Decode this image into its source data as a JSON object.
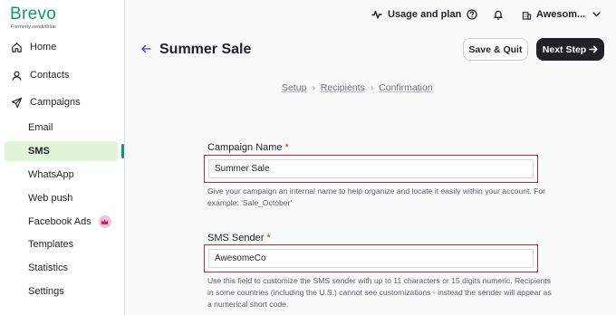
{
  "brand": {
    "name": "Brevo",
    "sub": "Formerly sendinblue",
    "color": "#0b996e"
  },
  "sidebar": {
    "items": [
      {
        "label": "Home",
        "icon": "home-icon"
      },
      {
        "label": "Contacts",
        "icon": "contacts-icon"
      },
      {
        "label": "Campaigns",
        "icon": "send-icon"
      },
      {
        "label": "Email"
      },
      {
        "label": "SMS",
        "active": true
      },
      {
        "label": "WhatsApp"
      },
      {
        "label": "Web push"
      },
      {
        "label": "Facebook Ads",
        "badge_icon": "crown-icon"
      },
      {
        "label": "Templates"
      },
      {
        "label": "Statistics"
      },
      {
        "label": "Settings"
      }
    ]
  },
  "topbar": {
    "usage_label": "Usage and plan",
    "account_label": "Awesom..."
  },
  "header": {
    "title": "Summer Sale",
    "save_label": "Save & Quit",
    "next_label": "Next Step"
  },
  "breadcrumb": [
    "Setup",
    "Recipients",
    "Confirmation"
  ],
  "form": {
    "campaign_name": {
      "label": "Campaign Name",
      "required": "*",
      "value": "Summer Sale",
      "help": "Give your campaign an internal name to help organize and locate it easily within your account. For example: 'Sale_October'"
    },
    "sms_sender": {
      "label": "SMS Sender",
      "required": "*",
      "value": "AwesomeCo",
      "help": "Use this field to customize the SMS sender with up to 11 characters or 15 digits numeric. Recipients in some countries (including the U.S.) cannot see customizations - instead the sender will appear as a numerical short code."
    }
  },
  "colors": {
    "active_bg": "#e2f5d6",
    "highlight_border": "#c8283a",
    "primary_dark": "#1f2328"
  }
}
